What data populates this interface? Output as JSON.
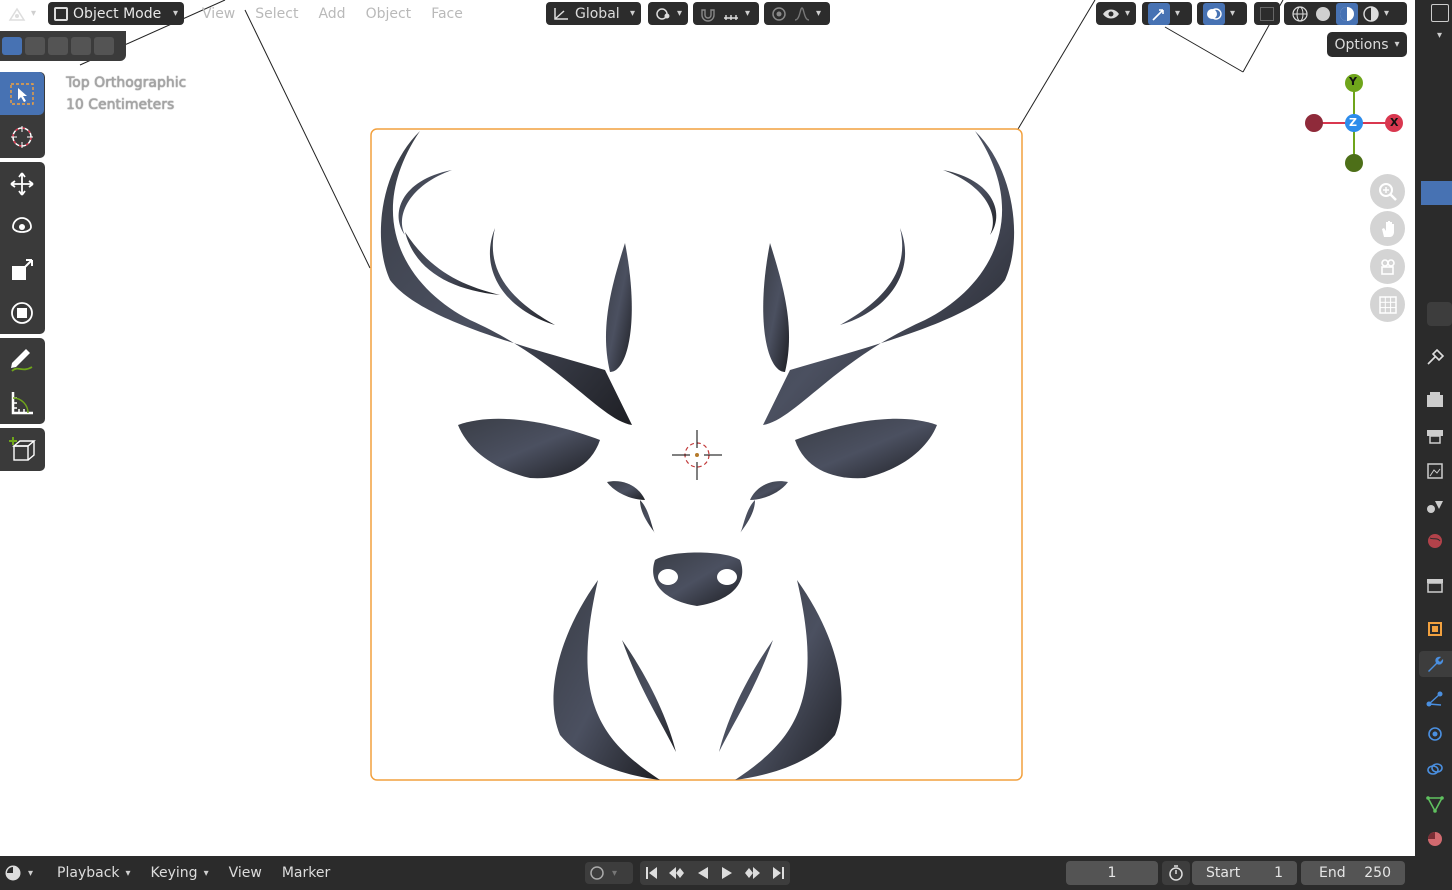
{
  "header": {
    "mode": "Object Mode",
    "menus": [
      "View",
      "Select",
      "Add",
      "Object",
      "Face"
    ],
    "orientation": "Global",
    "options_label": "Options"
  },
  "viewport": {
    "view_name": "Top Orthographic",
    "scale_label": "10 Centimeters"
  },
  "gizmo": {
    "y": "Y",
    "x": "X",
    "z": "Z"
  },
  "timeline": {
    "menus": [
      "Playback",
      "Keying",
      "View",
      "Marker"
    ],
    "current_frame": "1",
    "start_label": "Start",
    "start_value": "1",
    "end_label": "End",
    "end_value": "250"
  },
  "colors": {
    "selection_outline": "#f2a13f",
    "active_tool": "#4772b3",
    "axis_x": "#d9374f",
    "axis_y": "#6fa51b",
    "axis_z": "#2d8ceb"
  }
}
